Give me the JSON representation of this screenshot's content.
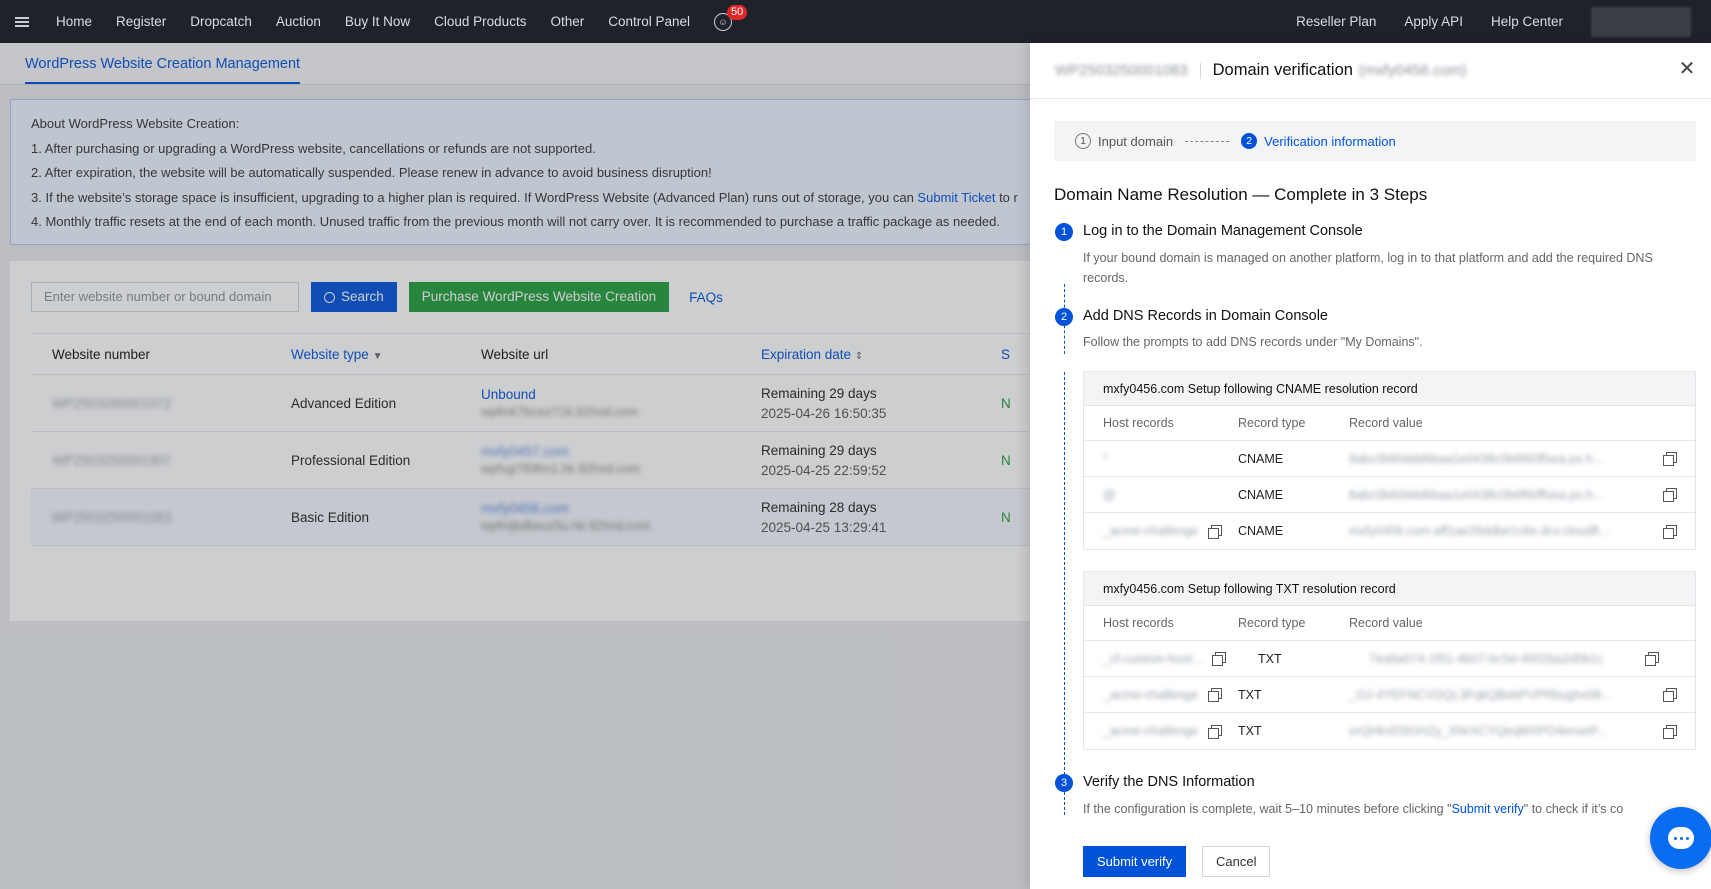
{
  "nav": {
    "items": [
      "Home",
      "Register",
      "Dropcatch",
      "Auction",
      "Buy It Now",
      "Cloud Products",
      "Other",
      "Control Panel"
    ],
    "badge_count": "50",
    "right_items": [
      "Reseller Plan",
      "Apply API",
      "Help Center"
    ]
  },
  "page": {
    "tab": "WordPress Website Creation Management",
    "info": {
      "title": "About WordPress Website Creation:",
      "line1": "1. After purchasing or upgrading a WordPress website, cancellations or refunds are not supported.",
      "line2": "2. After expiration, the website will be automatically suspended. Please renew in advance to avoid business disruption!",
      "line3_pre": "3. If the website’s storage space is insufficient, upgrading to a higher plan is required. If WordPress Website (Advanced Plan) runs out of storage, you can ",
      "line3_link": "Submit Ticket",
      "line3_post": " to r",
      "line4": "4. Monthly traffic resets at the end of each month. Unused traffic from the previous month will not carry over. It is recommended to purchase a traffic package as needed."
    },
    "search_placeholder": "Enter website number or bound domain",
    "search_button": "Search",
    "purchase_button": "Purchase WordPress Website Creation",
    "faqs": "FAQs",
    "table": {
      "headers": [
        "Website number",
        "Website type",
        "Website url",
        "Expiration date",
        "S"
      ],
      "rows": [
        {
          "number": "WP2503260001072",
          "type": "Advanced Edition",
          "url": "Unbound",
          "url_sub": "wpfmk7bcwz71k.92hnd.com",
          "remaining": "Remaining 29 days",
          "date": "2025-04-26 16:50:35",
          "status": "N"
        },
        {
          "number": "WP2503250001907",
          "type": "Professional Edition",
          "url": "mxfy0457.com",
          "url_sub": "wpfxgi7f08m1.hk.92hnd.com",
          "remaining": "Remaining 29 days",
          "date": "2025-04-25 22:59:52",
          "status": "N"
        },
        {
          "number": "WP2503250001083",
          "type": "Basic Edition",
          "url": "mxfy0456.com",
          "url_sub": "wpfmjbdbeuz5u.hk.92hnd.com",
          "remaining": "Remaining 28 days",
          "date": "2025-04-25 13:29:41",
          "status": "N"
        }
      ]
    }
  },
  "drawer": {
    "id": "WP2503250001083",
    "title": "Domain verification",
    "domain": "(mxfy0456.com)",
    "steps": {
      "one": "Input domain",
      "two": "Verification information"
    },
    "heading": "Domain Name Resolution — Complete in 3 Steps",
    "step1": {
      "title": "Log in to the Domain Management Console",
      "desc": "If your bound domain is managed on another platform, log in to that platform and add the required DNS records."
    },
    "step2": {
      "title": "Add DNS Records in Domain Console",
      "desc": "Follow the prompts to add DNS records under \"My Domains\"."
    },
    "cname_card": {
      "title": "mxfy0456.com Setup following CNAME resolution record",
      "headers": [
        "Host records",
        "Record type",
        "Record value"
      ],
      "rows": [
        {
          "host": "*",
          "type": "CNAME",
          "value": "8abc0b60ddd6baa1e0438c0b6f60ffsea.ps.h..."
        },
        {
          "host": "@",
          "type": "CNAME",
          "value": "8abc0b60ddd6baa1e0438c0b6f60ffsea.ps.h..."
        },
        {
          "host": "_acme-challenge",
          "type": "CNAME",
          "value": "mxfy0456.com.aff1ae26ddbe1c6e.dcv.cloudfl..."
        }
      ]
    },
    "txt_card": {
      "title": "mxfy0456.com Setup following TXT resolution record",
      "headers": [
        "Host records",
        "Record type",
        "Record value"
      ],
      "rows": [
        {
          "host": "_cf-custom-host...",
          "type": "TXT",
          "value": "7ea6a074-1f51-4b07-bc5d-4002ba2d5b1c"
        },
        {
          "host": "_acme-challenge",
          "type": "TXT",
          "value": "_OJ-4YEFNCVDQL3FqkQBebPVPRbughx08..."
        },
        {
          "host": "_acme-challenge",
          "type": "TXT",
          "value": "orQHkvDSGHZy_XNrXCYQeqMXPO4enxeP..."
        }
      ]
    },
    "step3": {
      "title": "Verify the DNS Information",
      "desc_pre": "If the configuration is complete, wait 5–10 minutes before clicking \"",
      "desc_link": "Submit verify",
      "desc_post": "\" to check if it’s co"
    },
    "submit": "Submit verify",
    "cancel": "Cancel"
  }
}
